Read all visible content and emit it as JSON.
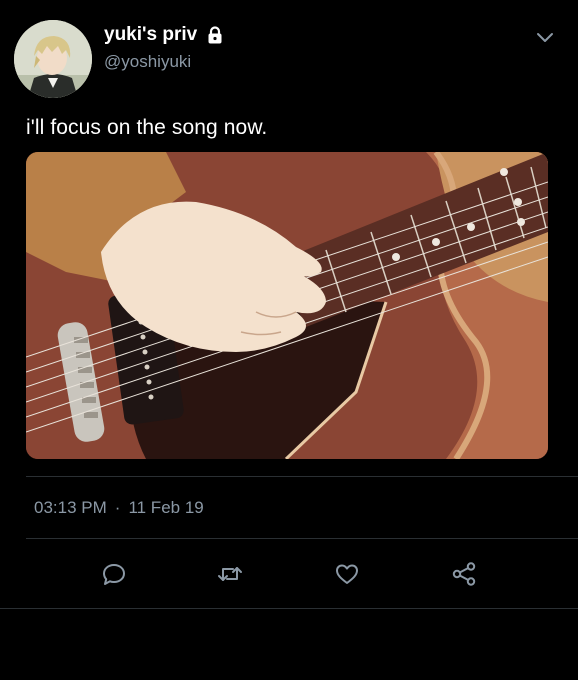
{
  "tweet": {
    "display_name": "yuki's priv",
    "handle": "@yoshiyuki",
    "text": "i'll focus on the song now.",
    "time": "03:13 PM",
    "separator": "·",
    "date": "11 Feb 19"
  },
  "icons": {
    "lock": "lock-icon",
    "menu": "chevron-down-icon",
    "reply": "reply-icon",
    "retweet": "retweet-icon",
    "like": "heart-icon",
    "share": "share-icon"
  },
  "colors": {
    "background": "#000000",
    "muted": "#8b98a5",
    "text": "#ffffff",
    "icon": "#8b98a5"
  }
}
